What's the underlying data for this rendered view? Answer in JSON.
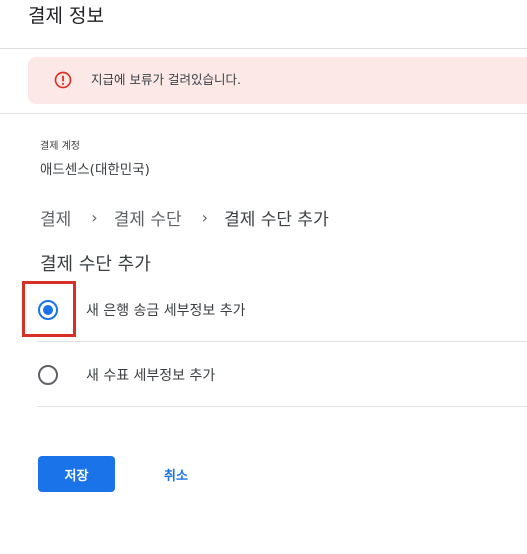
{
  "header": {
    "title": "결제 정보"
  },
  "alert": {
    "icon": "error-icon",
    "message": "지급에 보류가 걸려있습니다.",
    "color": "#d93025"
  },
  "account": {
    "label": "결제 계정",
    "value": "애드센스(대한민국)"
  },
  "breadcrumb": {
    "items": [
      "결제",
      "결제 수단",
      "결제 수단 추가"
    ],
    "separator": "›"
  },
  "section": {
    "title": "결제 수단 추가"
  },
  "options": [
    {
      "label": "새 은행 송금 세부정보 추가",
      "selected": true
    },
    {
      "label": "새 수표 세부정보 추가",
      "selected": false
    }
  ],
  "actions": {
    "save_label": "저장",
    "cancel_label": "취소"
  },
  "colors": {
    "accent": "#1a73e8",
    "alert_bg": "#fce8e6",
    "highlight": "#d93025"
  }
}
